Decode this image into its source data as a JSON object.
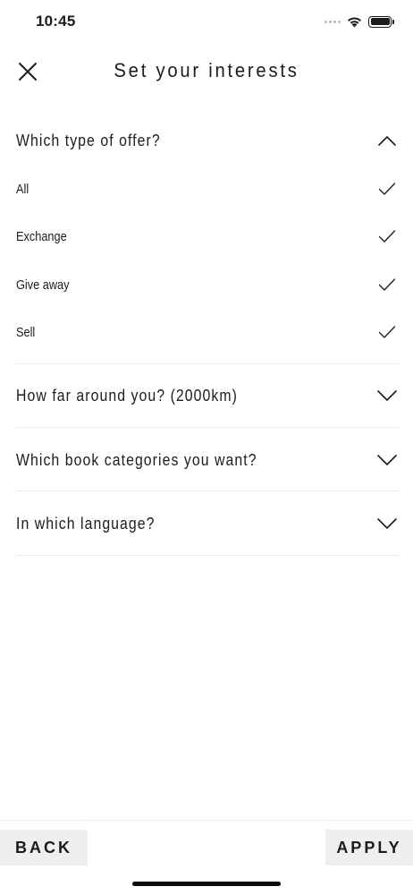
{
  "status_bar": {
    "time": "10:45"
  },
  "header": {
    "title": "Set your interests"
  },
  "sections": [
    {
      "label": "Which type of offer?",
      "expanded": true
    },
    {
      "label": "How far around you? (2000km)",
      "expanded": false
    },
    {
      "label": "Which book categories you want?",
      "expanded": false
    },
    {
      "label": "In which language?",
      "expanded": false
    }
  ],
  "offer_options": [
    {
      "label": "All",
      "checked": true
    },
    {
      "label": "Exchange",
      "checked": true
    },
    {
      "label": "Give away",
      "checked": true
    },
    {
      "label": "Sell",
      "checked": true
    }
  ],
  "footer": {
    "back_label": "BACK",
    "apply_label": "APPLY"
  },
  "icons": {
    "close": "close-icon",
    "chevron_up": "chevron-up-icon",
    "chevron_down": "chevron-down-icon",
    "check": "checkmark-icon"
  }
}
